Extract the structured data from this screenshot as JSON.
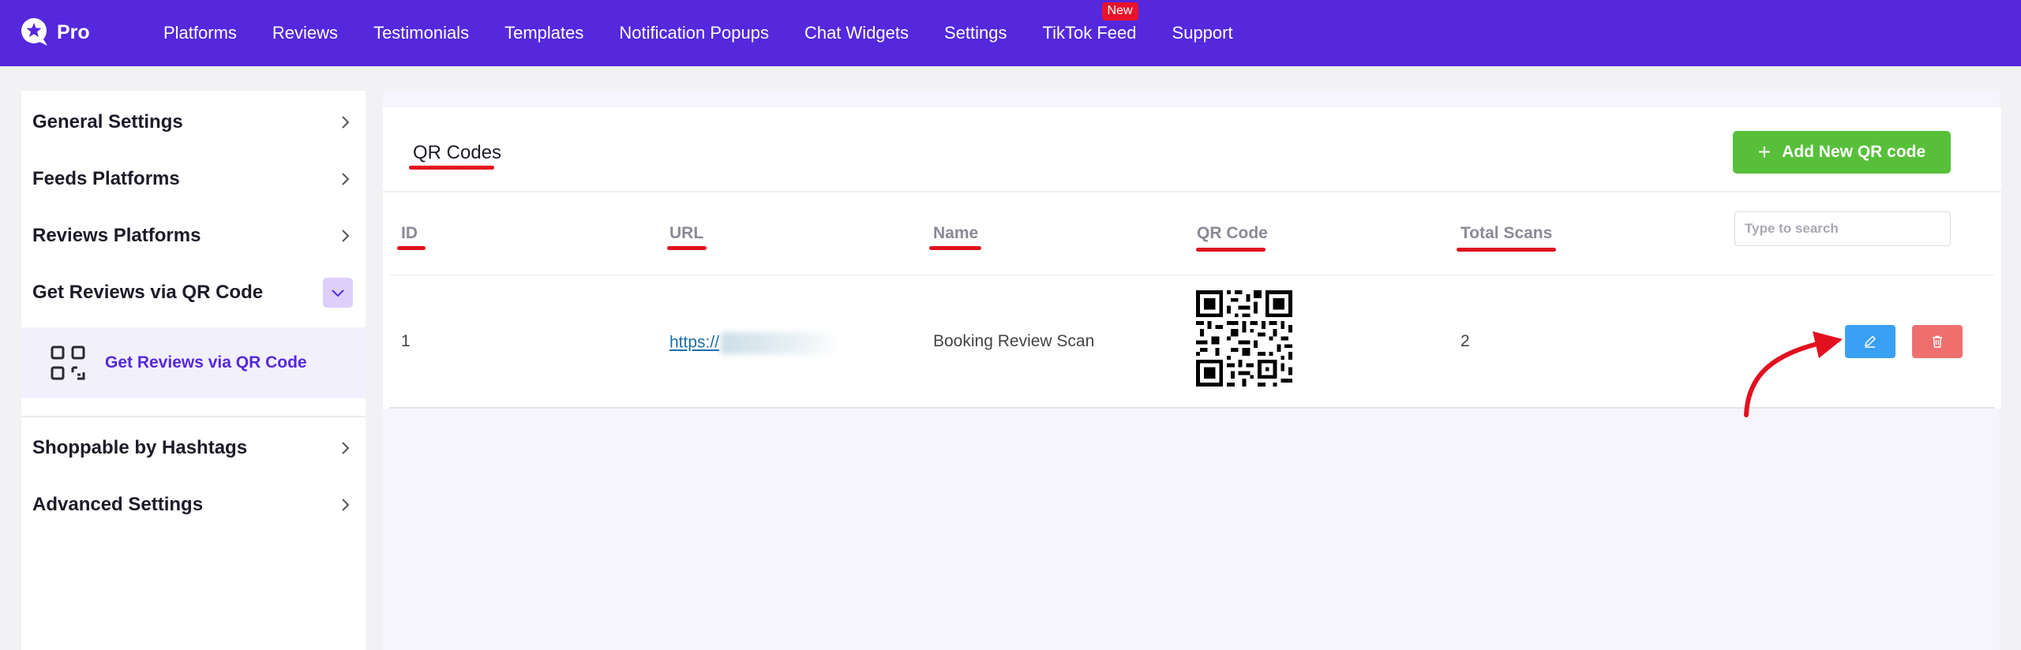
{
  "topnav": {
    "logo_text": "Pro",
    "items": [
      "Platforms",
      "Reviews",
      "Testimonials",
      "Templates",
      "Notification Popups",
      "Chat Widgets",
      "Settings",
      "TikTok Feed",
      "Support"
    ],
    "badge": "New",
    "accent_color": "#5528dd"
  },
  "sidebar": {
    "items": [
      {
        "label": "General Settings",
        "icon": "chevron-right-icon"
      },
      {
        "label": "Feeds Platforms",
        "icon": "chevron-right-icon"
      },
      {
        "label": "Reviews Platforms",
        "icon": "chevron-right-icon"
      },
      {
        "label": "Get Reviews via QR Code",
        "icon": "chevron-down-icon",
        "expanded": true
      },
      {
        "label": "Shoppable by Hashtags",
        "icon": "chevron-right-icon"
      },
      {
        "label": "Advanced Settings",
        "icon": "chevron-right-icon"
      }
    ],
    "active_sub_item": {
      "label": "Get Reviews via QR Code",
      "icon": "qr-code-icon"
    }
  },
  "main": {
    "title": "QR Codes",
    "add_button": "Add New QR code",
    "search_placeholder": "Type to search",
    "columns": [
      "ID",
      "URL",
      "Name",
      "QR Code",
      "Total Scans"
    ],
    "rows": [
      {
        "id": "1",
        "url": "https://",
        "name": "Booking Review Scan",
        "qr": "qr-code-image",
        "total_scans": "2"
      }
    ],
    "row_actions": [
      "edit-icon",
      "trash-icon"
    ],
    "colors": {
      "add_button": "#58bf3b",
      "edit_button": "#3aa0f3",
      "delete_button": "#ef6f6f",
      "annotation": "#e3101f"
    }
  }
}
